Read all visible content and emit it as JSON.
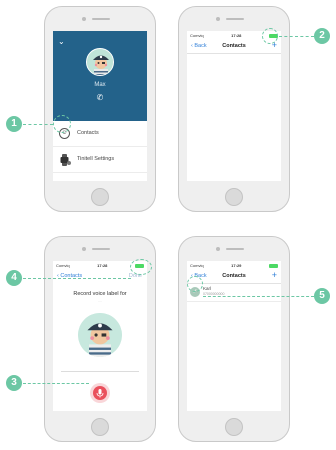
{
  "screen1": {
    "profile_name": "Max",
    "menu_items": [
      {
        "label": "Contacts"
      },
      {
        "label": "Tinitell Settings"
      }
    ]
  },
  "status_bars": [
    {
      "carrier": "Comviq",
      "time": "17:28"
    },
    {
      "carrier": "Comviq",
      "time": "17:28"
    },
    {
      "carrier": "Comviq",
      "time": "17:29"
    }
  ],
  "screen2": {
    "back_label": "Back",
    "title": "Contacts",
    "add_symbol": "+"
  },
  "screen3": {
    "back_label": "Contacts",
    "done_label": "Done",
    "record_text": "Record voice label for",
    "record_sub": "...."
  },
  "screen4": {
    "back_label": "Back",
    "title": "Contacts",
    "add_symbol": "+",
    "contact_name": "Karl",
    "contact_phone": "07000000000"
  },
  "callouts": [
    "1",
    "2",
    "3",
    "4",
    "5"
  ],
  "colors": {
    "accent": "#6cc7a4",
    "profile_bg": "#23628a",
    "ios_blue": "#2f7fd8",
    "record_red": "#ea4f5c"
  }
}
